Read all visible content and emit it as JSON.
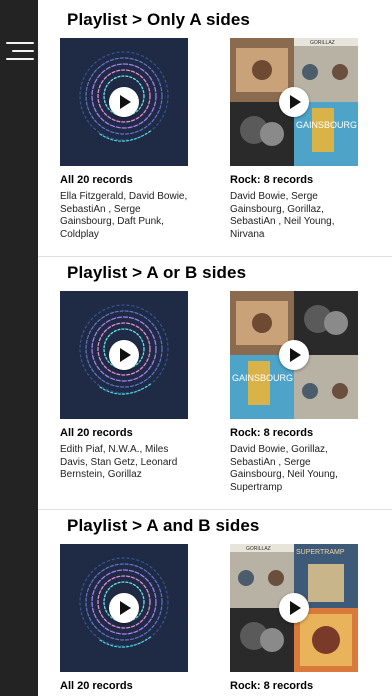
{
  "sidebar": {
    "menu_icon": "hamburger-menu-icon"
  },
  "colors": {
    "sidebar": "#232323",
    "text": "#111111",
    "generic_cover_bg": "#1f2b45",
    "play_button": "#ffffff"
  },
  "sections": [
    {
      "title": "Playlist > Only A sides",
      "cards": [
        {
          "title": "All 20 records",
          "artists": "Ella Fitzgerald, David Bowie, SebastiAn , Serge Gainsbourg, Daft Punk, Coldplay"
        },
        {
          "title": "Rock: 8 records",
          "artists": "David Bowie, Serge Gainsbourg, Gorillaz, SebastiAn , Neil Young, Nirvana"
        }
      ]
    },
    {
      "title": "Playlist > A or B sides",
      "cards": [
        {
          "title": "All 20 records",
          "artists": "Edith Piaf, N.W.A., Miles Davis, Stan Getz, Leonard Bernstein, Gorillaz"
        },
        {
          "title": "Rock: 8 records",
          "artists": "David Bowie, Gorillaz, SebastiAn , Serge Gainsbourg, Neil Young, Supertramp"
        }
      ]
    },
    {
      "title": "Playlist > A and B sides",
      "cards": [
        {
          "title": "All 20 records",
          "artists": ""
        },
        {
          "title": "Rock: 8 records",
          "artists": ""
        }
      ]
    }
  ],
  "cover_art": {
    "gorillaz_label": "GORILLAZ",
    "gainsbourg_label": "GAINSBOURG",
    "supertramp_label": "SUPERTRAMP"
  }
}
